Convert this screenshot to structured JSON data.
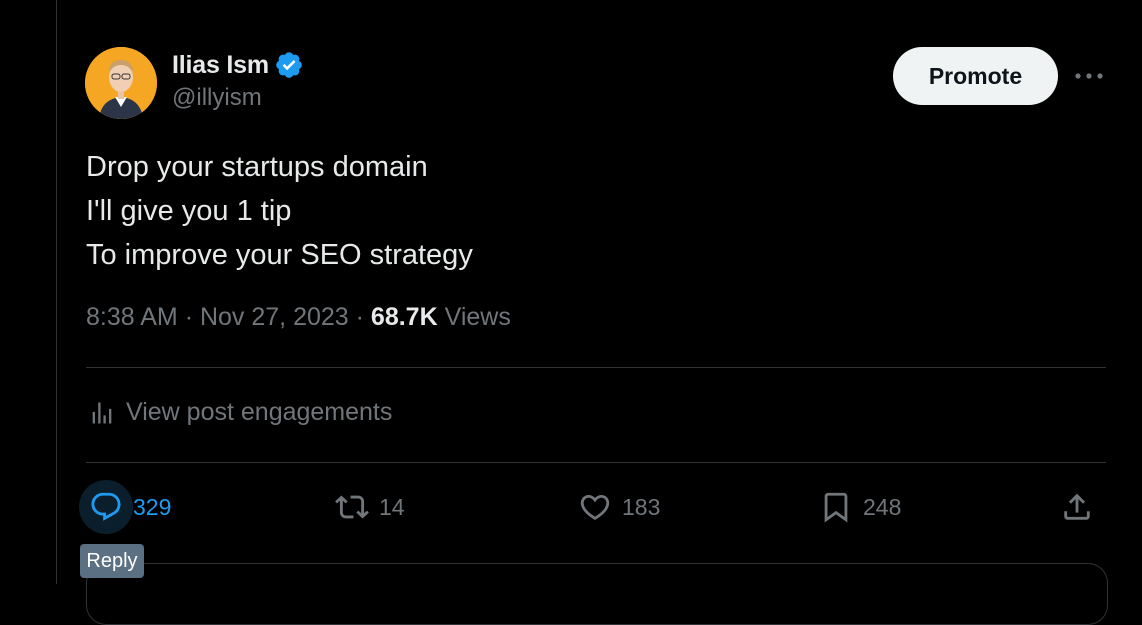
{
  "author": {
    "display_name": "Ilias Ism",
    "handle": "@illyism",
    "verified": true
  },
  "header": {
    "promote_label": "Promote"
  },
  "tweet": {
    "lines": [
      "Drop your startups domain",
      "I'll give you 1 tip",
      "To improve your SEO strategy"
    ],
    "time": "8:38 AM",
    "date": "Nov 27, 2023",
    "views_count": "68.7K",
    "views_label": "Views"
  },
  "engagements_label": "View post engagements",
  "actions": {
    "reply": {
      "count": "329",
      "icon": "reply-icon"
    },
    "retweet": {
      "count": "14",
      "icon": "retweet-icon"
    },
    "like": {
      "count": "183",
      "icon": "heart-icon"
    },
    "bookmark": {
      "count": "248",
      "icon": "bookmark-icon"
    },
    "share": {
      "icon": "share-icon"
    }
  },
  "tooltip": "Reply",
  "colors": {
    "background": "#000000",
    "text": "#e7e9ea",
    "secondary": "#71767b",
    "accent": "#1d9bf0",
    "verified": "#1d9bf0"
  }
}
